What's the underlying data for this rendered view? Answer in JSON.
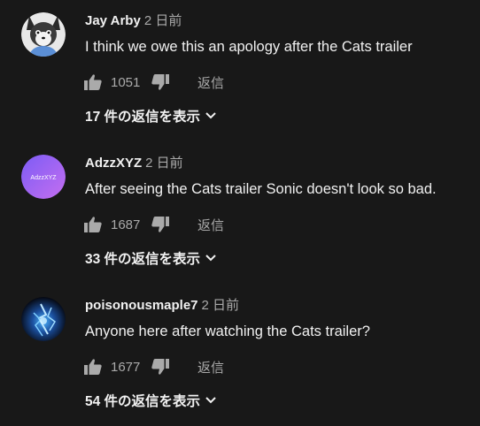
{
  "comments": [
    {
      "author": "Jay Arby",
      "time": "2 日前",
      "text": "I think we owe this an apology after the Cats trailer",
      "likes": "1051",
      "reply_label": "返信",
      "view_replies": "17 件の返信を表示",
      "avatar": "cartoon-wolf-avatar"
    },
    {
      "author": "AdzzXYZ",
      "time": "2 日前",
      "text": "After seeing the Cats trailer Sonic doesn't look so bad.",
      "likes": "1687",
      "reply_label": "返信",
      "view_replies": "33 件の返信を表示",
      "avatar": "purple-gradient-avatar",
      "avatar_text": "AdzzXYZ"
    },
    {
      "author": "poisonousmaple7",
      "time": "2 日前",
      "text": "Anyone here after watching the Cats trailer?",
      "likes": "1677",
      "reply_label": "返信",
      "view_replies": "54 件の返信を表示",
      "avatar": "blue-lightning-avatar"
    }
  ],
  "icons": {
    "like": "thumb-up-icon",
    "dislike": "thumb-down-icon",
    "expand": "chevron-down-icon"
  },
  "colors": {
    "background": "#181818",
    "primary_text": "#f1f1f1",
    "secondary_text": "#aaaaaa",
    "avatar_purple_start": "#8a5cf6",
    "avatar_purple_end": "#c06cf0"
  }
}
